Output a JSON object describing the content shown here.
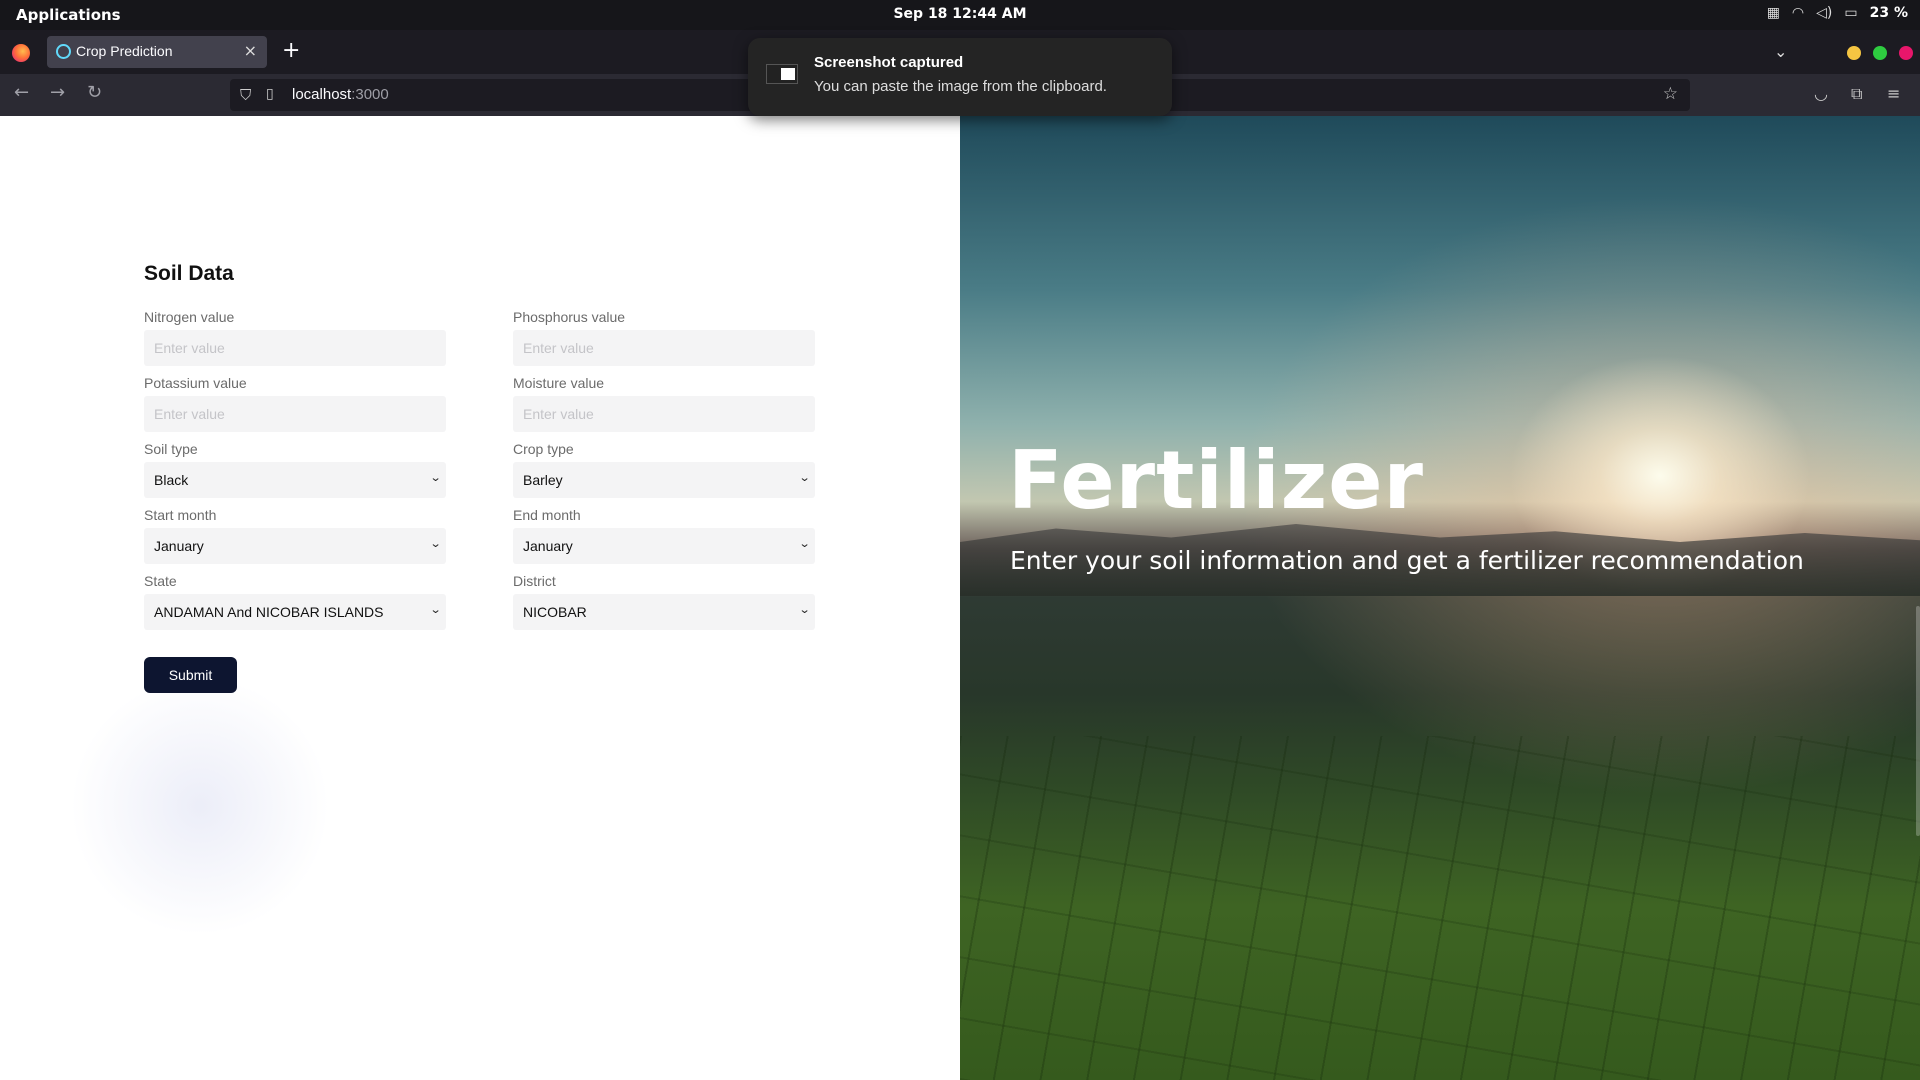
{
  "system_bar": {
    "applications_label": "Applications",
    "date_time": "Sep 18  12:44 AM",
    "battery": "23 %"
  },
  "browser": {
    "tab": {
      "title": "Crop Prediction",
      "icon": "react-icon"
    },
    "url": {
      "host": "localhost",
      "port": ":3000"
    },
    "window_button_colors": {
      "minimize": "#f5c542",
      "maximize": "#2ecc40",
      "close": "#e8166b"
    }
  },
  "notification": {
    "title": "Screenshot captured",
    "body": "You can paste the image from the clipboard."
  },
  "form": {
    "title": "Soil Data",
    "fields": [
      {
        "label": "Nitrogen value",
        "placeholder": "Enter value",
        "kind": "input"
      },
      {
        "label": "Phosphorus value",
        "placeholder": "Enter value",
        "kind": "input"
      },
      {
        "label": "Potassium value",
        "placeholder": "Enter value",
        "kind": "input"
      },
      {
        "label": "Moisture value",
        "placeholder": "Enter value",
        "kind": "input"
      },
      {
        "label": "Soil type",
        "value": "Black",
        "kind": "select"
      },
      {
        "label": "Crop type",
        "value": "Barley",
        "kind": "select"
      },
      {
        "label": "Start month",
        "value": "January",
        "kind": "select"
      },
      {
        "label": "End month",
        "value": "January",
        "kind": "select"
      },
      {
        "label": "State",
        "value": "ANDAMAN And NICOBAR ISLANDS",
        "kind": "select"
      },
      {
        "label": "District",
        "value": "NICOBAR",
        "kind": "select"
      }
    ],
    "submit_label": "Submit",
    "submit_color": "#0d1530"
  },
  "hero": {
    "title": "Fertilizer",
    "subtitle": "Enter your soil information and get a fertilizer recommendation"
  }
}
